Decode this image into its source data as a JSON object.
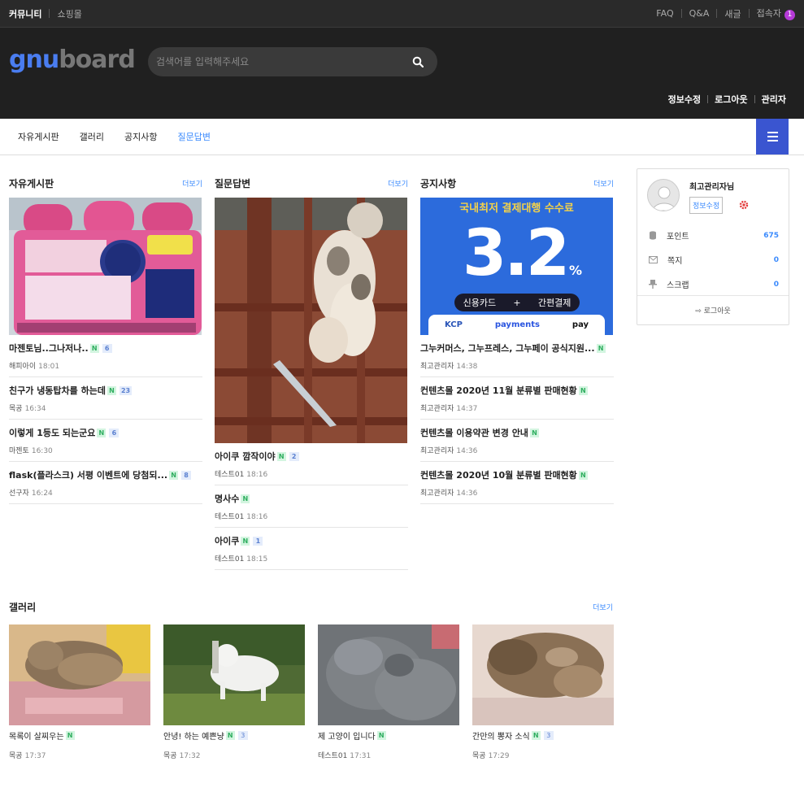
{
  "topbar": {
    "left": [
      "커뮤니티",
      "쇼핑몰"
    ],
    "right": [
      "FAQ",
      "Q&A",
      "새글",
      "접속자"
    ],
    "visitor_count": "1"
  },
  "header": {
    "logo_part1": "gnu",
    "logo_part2": "board",
    "search_placeholder": "검색어를 입력해주세요",
    "links": [
      "정보수정",
      "로그아웃",
      "관리자"
    ]
  },
  "nav": {
    "items": [
      "자유게시판",
      "갤러리",
      "공지사항",
      "질문답변"
    ],
    "active_index": 3
  },
  "boards": [
    {
      "title": "자유게시판",
      "more": "더보기",
      "posts": [
        {
          "title": "마젠토님..그나저나..",
          "new": "N",
          "comments": "6",
          "author": "해피아이",
          "time": "18:01"
        },
        {
          "title": "친구가 냉동탑차를 하는데",
          "new": "N",
          "comments": "23",
          "author": "목공",
          "time": "16:34"
        },
        {
          "title": "이렇게 1등도 되는군요",
          "new": "N",
          "comments": "6",
          "author": "마젠토",
          "time": "16:30"
        },
        {
          "title": "flask(플라스크) 서평 이벤트에 당첨되...",
          "new": "N",
          "comments": "8",
          "author": "선구자",
          "time": "16:24"
        }
      ]
    },
    {
      "title": "질문답변",
      "more": "더보기",
      "posts": [
        {
          "title": "아이쿠 깜작이야",
          "new": "N",
          "comments": "2",
          "author": "테스트01",
          "time": "18:16"
        },
        {
          "title": "명사수",
          "new": "N",
          "comments": "",
          "author": "테스트01",
          "time": "18:16"
        },
        {
          "title": "아이쿠",
          "new": "N",
          "comments": "1",
          "author": "테스트01",
          "time": "18:15"
        }
      ]
    },
    {
      "title": "공지사항",
      "more": "더보기",
      "banner": {
        "top": "국내최저 결제대행 수수료",
        "rate": "3.2",
        "unit": "%",
        "pill_a": "신용카드",
        "pill_plus": "+",
        "pill_b": "간편결제",
        "brand1": "KCP",
        "brand2": "payments",
        "brand3": "pay"
      },
      "posts": [
        {
          "title": "그누커머스, 그누프레스, 그누페이 공식지원...",
          "new": "N",
          "comments": "",
          "author": "최고관리자",
          "time": "14:38"
        },
        {
          "title": "컨텐츠몰 2020년 11월 분류별 판매현황",
          "new": "N",
          "comments": "",
          "author": "최고관리자",
          "time": "14:37"
        },
        {
          "title": "컨텐츠몰 이용약관 변경 안내",
          "new": "N",
          "comments": "",
          "author": "최고관리자",
          "time": "14:36"
        },
        {
          "title": "컨텐츠몰 2020년 10월 분류별 판매현황",
          "new": "N",
          "comments": "",
          "author": "최고관리자",
          "time": "14:36"
        }
      ]
    }
  ],
  "profile": {
    "name": "최고관리자님",
    "edit": "정보수정",
    "stats": [
      {
        "label": "포인트",
        "value": "675"
      },
      {
        "label": "쪽지",
        "value": "0"
      },
      {
        "label": "스크랩",
        "value": "0"
      }
    ],
    "logout": "로그아웃"
  },
  "gallery": {
    "title": "갤러리",
    "more": "더보기",
    "items": [
      {
        "title": "목록이 살찌우는",
        "new": "N",
        "comments": "",
        "author": "목공",
        "time": "17:37"
      },
      {
        "title": "안녕! 하는 예쁜냥",
        "new": "N",
        "comments": "3",
        "author": "목공",
        "time": "17:32"
      },
      {
        "title": "제 고양이 입니다",
        "new": "N",
        "comments": "",
        "author": "테스트01",
        "time": "17:31"
      },
      {
        "title": "간만의 뽕자 소식",
        "new": "N",
        "comments": "3",
        "author": "목공",
        "time": "17:29"
      }
    ]
  },
  "colors": {
    "accent": "#3a8afd",
    "menu": "#3a55d0",
    "dark": "#202020"
  }
}
